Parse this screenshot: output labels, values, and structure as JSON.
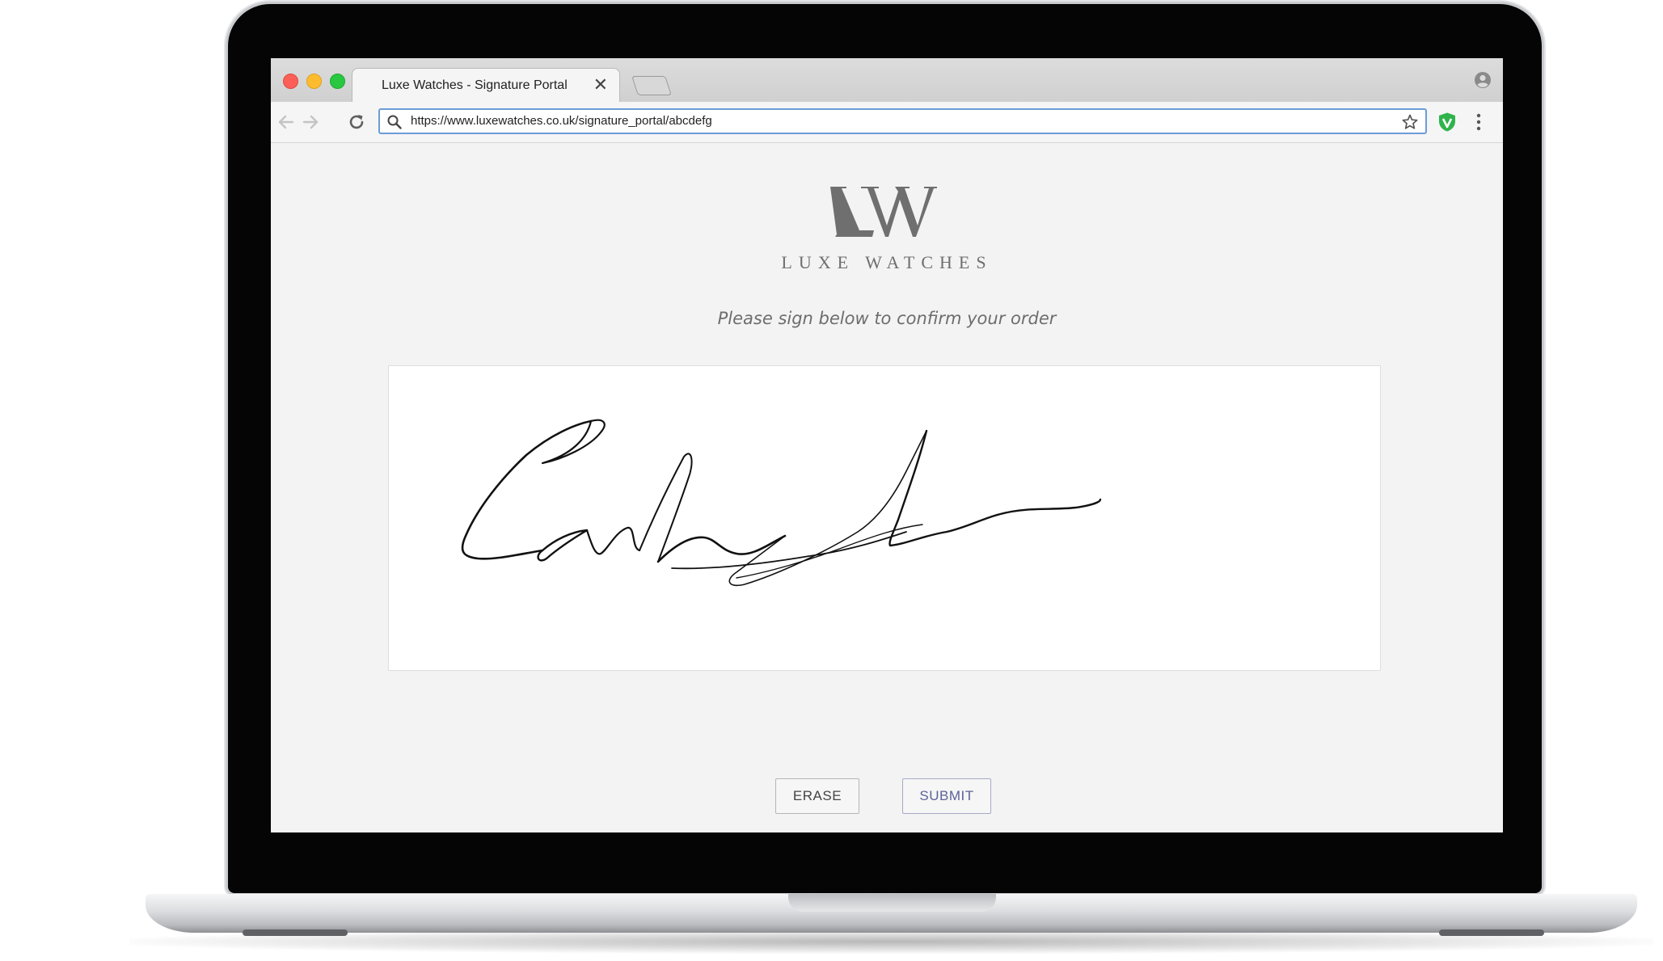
{
  "browser": {
    "tab_title": "Luxe Watches - Signature Portal",
    "url": "https://www.luxewatches.co.uk/signature_portal/abcdefg"
  },
  "page": {
    "logo_monogram": "LW",
    "brand_name": "LUXE WATCHES",
    "instruction": "Please sign below to confirm your order",
    "erase_label": "ERASE",
    "submit_label": "SUBMIT"
  },
  "icons": {
    "tab_close": "close-icon",
    "new_tab": "new-tab-icon",
    "profile": "account-circle-icon",
    "back": "back-arrow-icon",
    "forward": "forward-arrow-icon",
    "reload": "reload-icon",
    "search": "search-icon",
    "bookmark": "star-icon",
    "extension": "shield-icon",
    "menu": "more-vertical-icon"
  },
  "colors": {
    "page_background": "#f3f3f3",
    "submit_text": "#5d6398",
    "omnibox_focus": "#6c9cd8",
    "extension_green": "#2fb34a"
  }
}
